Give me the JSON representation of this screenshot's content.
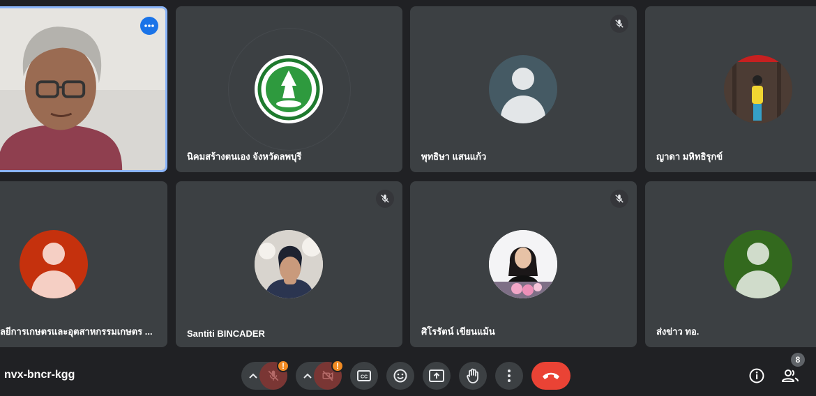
{
  "meeting": {
    "code": "nvx-bncr-kgg"
  },
  "participants": [
    {
      "name": "",
      "kind": "video"
    },
    {
      "name": "นิคมสร้างตนเอง จังหวัดลพบุรี",
      "kind": "logo"
    },
    {
      "name": "พุทธิษา แสนแก้ว",
      "kind": "default-avatar",
      "avatar_color": "#455a64",
      "muted": true
    },
    {
      "name": "ญาดา มหิทธิรุกข์",
      "kind": "photo"
    },
    {
      "name": "ลยีการเกษตรและอุตสาหกรรมเกษตร ...",
      "kind": "default-avatar",
      "avatar_color": "#c5310d"
    },
    {
      "name": "Santiti BINCADER",
      "kind": "photo",
      "muted": true
    },
    {
      "name": "ศิโรรัตน์ เขียนแม้น",
      "kind": "photo",
      "muted": true
    },
    {
      "name": "ส่งข่าว ทอ.",
      "kind": "default-avatar",
      "avatar_color": "#33691e",
      "muted": true
    }
  ],
  "controls": {
    "mic_warning": "!",
    "camera_warning": "!",
    "participants_count": "8"
  },
  "icons": [
    "more-options-icon",
    "mic-off-icon",
    "chevron-up-icon",
    "camera-off-icon",
    "captions-icon",
    "emoji-icon",
    "present-screen-icon",
    "raise-hand-icon",
    "more-vert-icon",
    "end-call-icon",
    "info-icon",
    "people-icon"
  ],
  "colors": {
    "accent": "#8ab4f8",
    "end_call": "#ea4335",
    "warning": "#f28b22",
    "tile_bg": "#3c4043",
    "bg": "#202124"
  }
}
